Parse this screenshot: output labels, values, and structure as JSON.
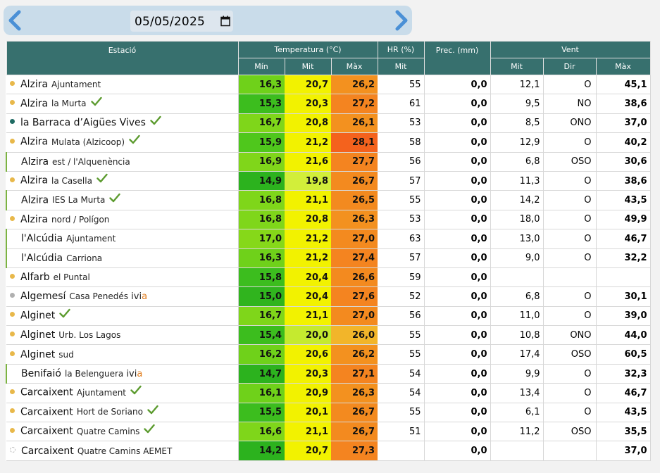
{
  "nav": {
    "date": "05/05/2025",
    "prev_icon": "chevron-left-icon",
    "next_icon": "chevron-right-icon",
    "calendar_icon": "calendar-icon"
  },
  "header": {
    "station": "Estació",
    "temperature": "Temperatura (°C)",
    "humidity": "HR (%)",
    "precip": "Prec. (mm)",
    "wind": "Vent",
    "temp_min": "Mín",
    "temp_avg": "Mit",
    "temp_max": "Màx",
    "hr_avg": "Mit",
    "wind_avg": "Mit",
    "wind_dir": "Dir",
    "wind_max": "Màx"
  },
  "colors": {
    "dot_yellow": "#e8b84a",
    "dot_gray": "#b0b0b0",
    "dot_teal": "#1f6b63",
    "check": "#5c9b2f",
    "ivia_orange": "#e07b1b"
  },
  "rows": [
    {
      "town": "Alzira",
      "place": "Ajuntament",
      "dot": "yellow",
      "check": false,
      "ivia": false,
      "min": "16,3",
      "avg": "20,7",
      "max": "26,2",
      "min_c": "#6fd11a",
      "avg_c": "#f2f200",
      "max_c": "#f3911f",
      "hr": "55",
      "prec": "0,0",
      "wavg": "12,1",
      "wdir": "O",
      "wmax": "45,1"
    },
    {
      "town": "Alzira",
      "place": "la Murta",
      "dot": "yellow",
      "check": true,
      "ivia": false,
      "min": "15,3",
      "avg": "20,3",
      "max": "27,2",
      "min_c": "#3cbd1e",
      "avg_c": "#f2f200",
      "max_c": "#f48420",
      "hr": "61",
      "prec": "0,0",
      "wavg": "9,5",
      "wdir": "NO",
      "wmax": "38,6"
    },
    {
      "town": "la Barraca d’Aigües Vives",
      "place": "",
      "dot": "teal",
      "check": true,
      "ivia": false,
      "min": "16,7",
      "avg": "20,8",
      "max": "26,1",
      "min_c": "#7fd61a",
      "avg_c": "#f2f200",
      "max_c": "#f3911f",
      "hr": "53",
      "prec": "0,0",
      "wavg": "8,5",
      "wdir": "ONO",
      "wmax": "37,0"
    },
    {
      "town": "Alzira",
      "place": "Mulata (Alzicoop)",
      "dot": "yellow",
      "check": true,
      "ivia": false,
      "min": "15,9",
      "avg": "21,2",
      "max": "28,1",
      "min_c": "#4fc71c",
      "avg_c": "#f2f200",
      "max_c": "#f4621d",
      "hr": "58",
      "prec": "0,0",
      "wavg": "12,9",
      "wdir": "O",
      "wmax": "40,2"
    },
    {
      "town": "Alzira",
      "place": "est / l'Alquenència",
      "dot": "none",
      "check": false,
      "ivia": false,
      "min": "16,9",
      "avg": "21,6",
      "max": "27,7",
      "min_c": "#80d61a",
      "avg_c": "#f2f200",
      "max_c": "#f48420",
      "hr": "56",
      "prec": "0,0",
      "wavg": "6,8",
      "wdir": "OSO",
      "wmax": "30,6"
    },
    {
      "town": "Alzira",
      "place": "la Casella",
      "dot": "yellow",
      "check": true,
      "ivia": false,
      "min": "14,9",
      "avg": "19,8",
      "max": "26,7",
      "min_c": "#2cb21e",
      "avg_c": "#d2ee3a",
      "max_c": "#f38a1f",
      "hr": "57",
      "prec": "0,0",
      "wavg": "11,3",
      "wdir": "O",
      "wmax": "38,6"
    },
    {
      "town": "Alzira",
      "place": "IES La Murta",
      "dot": "none",
      "check": true,
      "ivia": false,
      "min": "16,8",
      "avg": "21,1",
      "max": "26,5",
      "min_c": "#7fd61a",
      "avg_c": "#f2f200",
      "max_c": "#f38a1f",
      "hr": "55",
      "prec": "0,0",
      "wavg": "14,2",
      "wdir": "O",
      "wmax": "43,5"
    },
    {
      "town": "Alzira",
      "place": "nord / Polígon",
      "dot": "yellow",
      "check": false,
      "ivia": false,
      "min": "16,8",
      "avg": "20,8",
      "max": "26,3",
      "min_c": "#7fd61a",
      "avg_c": "#f2f200",
      "max_c": "#f3911f",
      "hr": "53",
      "prec": "0,0",
      "wavg": "18,0",
      "wdir": "O",
      "wmax": "49,9"
    },
    {
      "town": "l'Alcúdia",
      "place": "Ajuntament",
      "dot": "none",
      "check": false,
      "ivia": false,
      "min": "17,0",
      "avg": "21,2",
      "max": "27,0",
      "min_c": "#86d819",
      "avg_c": "#f2f200",
      "max_c": "#f38a1f",
      "hr": "63",
      "prec": "0,0",
      "wavg": "13,0",
      "wdir": "O",
      "wmax": "46,7"
    },
    {
      "town": "l'Alcúdia",
      "place": "Carriona",
      "dot": "none",
      "check": false,
      "ivia": false,
      "min": "16,3",
      "avg": "21,2",
      "max": "27,4",
      "min_c": "#6fd11a",
      "avg_c": "#f2f200",
      "max_c": "#f48420",
      "hr": "57",
      "prec": "0,0",
      "wavg": "9,0",
      "wdir": "O",
      "wmax": "32,2"
    },
    {
      "town": "Alfarb",
      "place": "el Puntal",
      "dot": "yellow",
      "check": false,
      "ivia": false,
      "min": "15,8",
      "avg": "20,4",
      "max": "26,6",
      "min_c": "#3cbd1e",
      "avg_c": "#f2f200",
      "max_c": "#f38a1f",
      "hr": "59",
      "prec": "0,0",
      "wavg": "",
      "wdir": "",
      "wmax": ""
    },
    {
      "town": "Algemesí",
      "place": "Casa Penedés",
      "dot": "gray",
      "check": false,
      "ivia": true,
      "min": "15,0",
      "avg": "20,4",
      "max": "27,6",
      "min_c": "#30b41e",
      "avg_c": "#f2f200",
      "max_c": "#f48420",
      "hr": "52",
      "prec": "0,0",
      "wavg": "6,8",
      "wdir": "O",
      "wmax": "30,1"
    },
    {
      "town": "Alginet",
      "place": "",
      "dot": "yellow",
      "check": true,
      "ivia": false,
      "min": "16,7",
      "avg": "21,1",
      "max": "27,0",
      "min_c": "#7fd61a",
      "avg_c": "#f2f200",
      "max_c": "#f38a1f",
      "hr": "56",
      "prec": "0,0",
      "wavg": "11,0",
      "wdir": "O",
      "wmax": "39,0"
    },
    {
      "town": "Alginet",
      "place": "Urb. Los Lagos",
      "dot": "yellow",
      "check": false,
      "ivia": false,
      "min": "15,4",
      "avg": "20,0",
      "max": "26,0",
      "min_c": "#3cbd1e",
      "avg_c": "#c5ea2f",
      "max_c": "#f2b52a",
      "hr": "55",
      "prec": "0,0",
      "wavg": "10,8",
      "wdir": "ONO",
      "wmax": "44,0"
    },
    {
      "town": "Alginet",
      "place": "sud",
      "dot": "yellow",
      "check": false,
      "ivia": false,
      "min": "16,2",
      "avg": "20,6",
      "max": "26,2",
      "min_c": "#6fd11a",
      "avg_c": "#f2f200",
      "max_c": "#f3911f",
      "hr": "55",
      "prec": "0,0",
      "wavg": "17,4",
      "wdir": "OSO",
      "wmax": "60,5"
    },
    {
      "town": "Benifaió",
      "place": "la Belenguera",
      "dot": "none",
      "check": false,
      "ivia": true,
      "min": "14,7",
      "avg": "20,3",
      "max": "27,1",
      "min_c": "#2cb21e",
      "avg_c": "#f2f200",
      "max_c": "#f48420",
      "hr": "54",
      "prec": "0,0",
      "wavg": "9,9",
      "wdir": "O",
      "wmax": "32,3"
    },
    {
      "town": "Carcaixent",
      "place": "Ajuntament",
      "dot": "yellow",
      "check": true,
      "ivia": false,
      "min": "16,1",
      "avg": "20,9",
      "max": "26,3",
      "min_c": "#6fd11a",
      "avg_c": "#f2f200",
      "max_c": "#f3911f",
      "hr": "54",
      "prec": "0,0",
      "wavg": "13,4",
      "wdir": "O",
      "wmax": "46,7"
    },
    {
      "town": "Carcaixent",
      "place": "Hort de Soriano",
      "dot": "yellow",
      "check": true,
      "ivia": false,
      "min": "15,5",
      "avg": "20,1",
      "max": "26,7",
      "min_c": "#3cbd1e",
      "avg_c": "#f2f200",
      "max_c": "#f38a1f",
      "hr": "55",
      "prec": "0,0",
      "wavg": "6,1",
      "wdir": "O",
      "wmax": "43,5"
    },
    {
      "town": "Carcaixent",
      "place": "Quatre Camins",
      "dot": "yellow",
      "check": true,
      "ivia": false,
      "min": "16,6",
      "avg": "21,1",
      "max": "26,7",
      "min_c": "#7fd61a",
      "avg_c": "#f2f200",
      "max_c": "#f38a1f",
      "hr": "51",
      "prec": "0,0",
      "wavg": "11,2",
      "wdir": "OSO",
      "wmax": "35,5"
    },
    {
      "town": "Carcaixent",
      "place": "Quatre Camins AEMET",
      "dot": "white",
      "check": false,
      "ivia": false,
      "min": "14,2",
      "avg": "20,7",
      "max": "27,3",
      "min_c": "#2cb21e",
      "avg_c": "#f2f200",
      "max_c": "#f48420",
      "hr": "",
      "prec": "0,0",
      "wavg": "",
      "wdir": "",
      "wmax": "37,0"
    }
  ]
}
